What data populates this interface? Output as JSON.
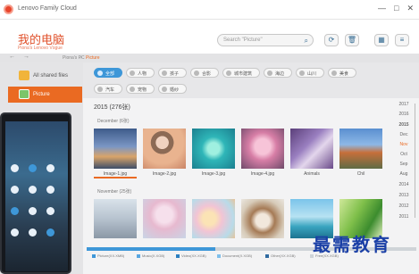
{
  "window": {
    "title": "Lenovo Family Cloud",
    "controls": [
      "—",
      "□",
      "✕"
    ]
  },
  "header": {
    "user_name": "我的电脑",
    "user_sub": "Рiona's Lenovo Vоgue",
    "search_placeholder": "Search \"Picture\""
  },
  "nav": {
    "breadcrumb": [
      "Piona's PC",
      "Picture"
    ]
  },
  "sidebar": {
    "items": [
      {
        "label": "All shared files"
      },
      {
        "label": "Picture"
      }
    ]
  },
  "filters": {
    "chips": [
      "全部",
      "人物",
      "孩子",
      "合影",
      "城市建筑",
      "海边",
      "山川",
      "美食",
      "汽车",
      "宠物",
      "婚纱"
    ]
  },
  "main": {
    "year_heading": "2015 (276张)",
    "sections": [
      {
        "label": "December (6张)",
        "items": [
          {
            "caption": "Image-1.jpg"
          },
          {
            "caption": "Image-2.jpg"
          },
          {
            "caption": "Image-3.jpg"
          },
          {
            "caption": "Image-4.jpg"
          },
          {
            "caption": "Animals"
          },
          {
            "caption": "Chil"
          }
        ]
      },
      {
        "label": "November (25张)",
        "items": [
          {
            "caption": ""
          },
          {
            "caption": ""
          },
          {
            "caption": ""
          },
          {
            "caption": ""
          },
          {
            "caption": ""
          },
          {
            "caption": ""
          }
        ]
      }
    ]
  },
  "timeline": [
    "2017",
    "2016",
    "2015",
    "Dec",
    "Nov",
    "Oct",
    "Sep",
    "Aug",
    "2014",
    "2013",
    "2012",
    "2011"
  ],
  "storage": {
    "used_fraction": 0.39,
    "legend": [
      {
        "label": "Picture(XX.XMB)",
        "color": "#3e97d8"
      },
      {
        "label": "Music(X.XGB)",
        "color": "#5aa6e0"
      },
      {
        "label": "Video(XX.XGB)",
        "color": "#2c7fc0"
      },
      {
        "label": "Document(X.XGB)",
        "color": "#80bfea"
      },
      {
        "label": "Other(XX.XGB)",
        "color": "#2f6aa0"
      },
      {
        "label": "Free(XX.XGB)",
        "color": "#cfd4d8"
      }
    ]
  },
  "watermark": "最需教育",
  "colors": {
    "accent": "#ea6a22",
    "blue": "#3e97d8"
  }
}
